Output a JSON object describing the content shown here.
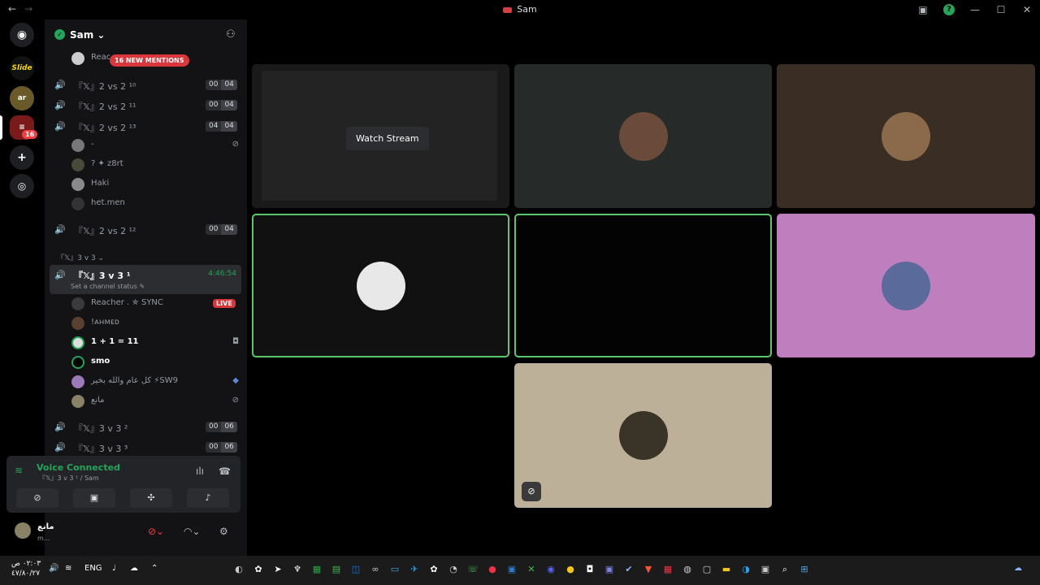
{
  "window": {
    "title": "Sam",
    "nav_back": "←",
    "nav_fwd": "→",
    "min": "—",
    "max": "☐",
    "close": "✕",
    "help": "?"
  },
  "guild": {
    "name": "Sam ⌄",
    "mention_pill": "16 NEW MENTIONS",
    "server_badge": "16",
    "server_label": "Slide"
  },
  "channels": {
    "reacher_peek": "Reac",
    "c10": {
      "name": "『𝕏』2 vs 2 ¹⁰",
      "a": "00",
      "b": "04"
    },
    "c11": {
      "name": "『𝕏』2 vs 2 ¹¹",
      "a": "00",
      "b": "04"
    },
    "c13": {
      "name": "『𝕏』2 vs 2 ¹³",
      "a": "04",
      "b": "04"
    },
    "c13_users": [
      "-",
      "? ✦ z8rt",
      "Haki",
      "het.men"
    ],
    "c12": {
      "name": "『𝕏』2 vs 2 ¹²",
      "a": "00",
      "b": "04"
    },
    "category": "『𝕏』3 v 3 ⌄",
    "active": {
      "name": "『𝕏』3 v 3 ¹",
      "status": "Set a channel status ✎",
      "timer": "4:46:54"
    },
    "active_users": [
      "Reacher . ✯ SYNC",
      "!ᴀʜᴍᴇᴅ",
      "1 + 1 = 11",
      "smo",
      "كل عام والله بخير ⚡SW9",
      "مانع"
    ],
    "live": "LIVE",
    "c2": {
      "name": "『𝕏』3 v 3 ²",
      "a": "00",
      "b": "06"
    },
    "c3": {
      "name": "『𝕏』3 v 3 ³",
      "a": "00",
      "b": "06"
    }
  },
  "voice": {
    "connected": "Voice Connected",
    "channel": "『𝕏』3 v 3 ¹ / Sam"
  },
  "user": {
    "name": "مانع",
    "status": "m..."
  },
  "stage": {
    "watch": "Watch Stream"
  },
  "taskbar": {
    "time": "٠٢:٠٣ ص",
    "date": "٤٧/٨٠/٢٧",
    "lang": "ENG"
  }
}
